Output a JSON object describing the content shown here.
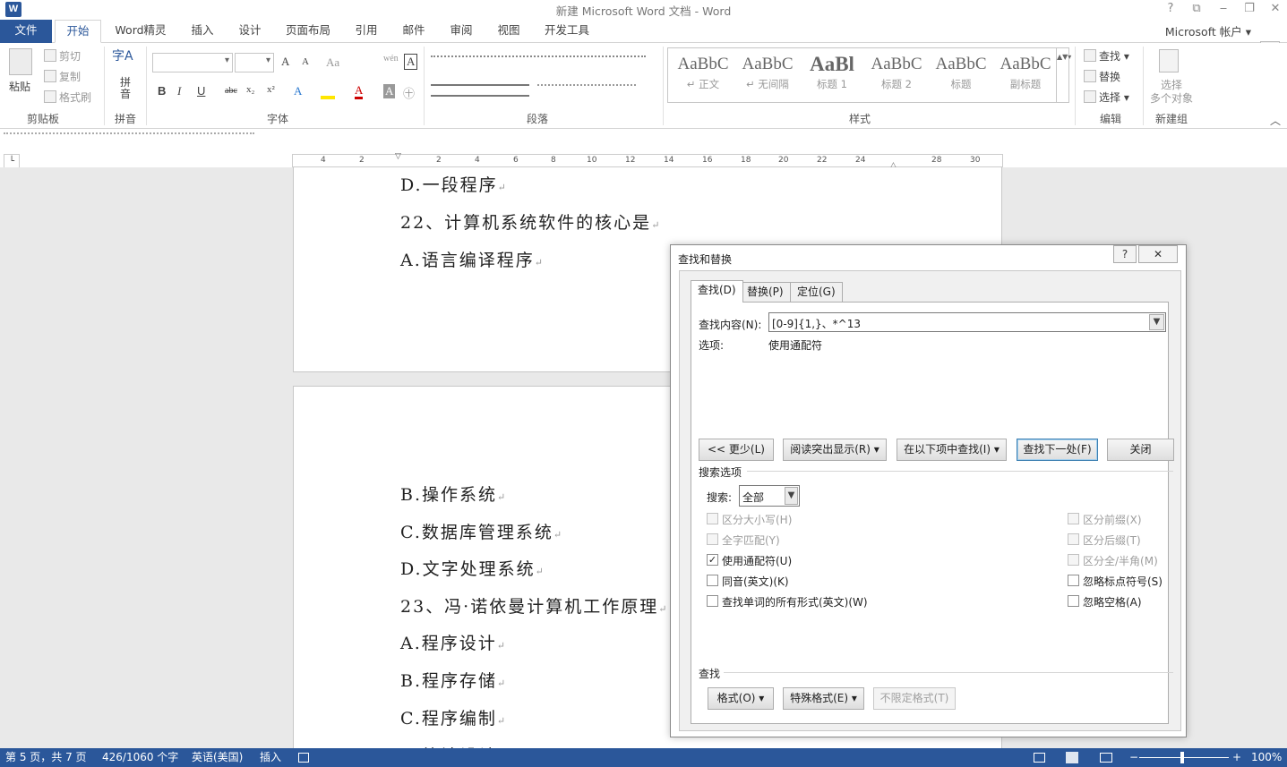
{
  "title_bar": {
    "title": "新建 Microsoft Word 文档 - Word",
    "logo": "W",
    "help": "?",
    "ribbon_display": "⧉",
    "minimize": "‒",
    "restore": "❐",
    "close": "✕"
  },
  "menu_tabs": {
    "file": "文件",
    "home": "开始",
    "word_jl": "Word精灵",
    "insert": "插入",
    "design": "设计",
    "layout": "页面布局",
    "references": "引用",
    "mailings": "邮件",
    "review": "审阅",
    "view": "视图",
    "developer": "开发工具"
  },
  "account": "Microsoft 帐户 ▾",
  "ribbon": {
    "clipboard": {
      "paste": "粘贴",
      "cut": "剪切",
      "copy": "复制",
      "format_painter": "格式刷",
      "group": "剪贴板"
    },
    "pinyin": {
      "label_top": "字A",
      "label": "拼\n音",
      "group": "拼音"
    },
    "font": {
      "group": "字体",
      "bold": "B",
      "italic": "I",
      "underline": "U",
      "strike": "abc",
      "sub": "x₂",
      "sup": "x²",
      "grow": "A",
      "shrink": "A",
      "aa": "Aa",
      "wen": "wén",
      "a_box": "A",
      "a_effect": "A",
      "a_color": "A",
      "a_shade": "A",
      "enclose": "㊉"
    },
    "paragraph": {
      "group": "段落"
    },
    "styles": {
      "group": "样式",
      "items": [
        {
          "sample": "AaBbC",
          "name": "↵ 正文"
        },
        {
          "sample": "AaBbC",
          "name": "↵ 无间隔"
        },
        {
          "sample": "AaBl",
          "name": "标题 1"
        },
        {
          "sample": "AaBbC",
          "name": "标题 2"
        },
        {
          "sample": "AaBbC",
          "name": "标题"
        },
        {
          "sample": "AaBbC",
          "name": "副标题"
        }
      ]
    },
    "editing": {
      "group": "编辑",
      "find": "查找",
      "replace": "替换",
      "select": "选择"
    },
    "new_group": {
      "group": "新建组",
      "label": "选择\n多个对象"
    }
  },
  "ruler_ticks": [
    "4",
    "2",
    "2",
    "4",
    "6",
    "8",
    "10",
    "12",
    "14",
    "16",
    "18",
    "20",
    "22",
    "24",
    "28",
    "30"
  ],
  "document": {
    "lines_page1": [
      "D.一段程序",
      "22、计算机系统软件的核心是",
      "A.语言编译程序"
    ],
    "lines_page2": [
      "B.操作系统",
      "C.数据库管理系统",
      "D.文字处理系统",
      "23、冯·诺依曼计算机工作原理",
      "A.程序设计",
      "B.程序存储",
      "C.程序编制",
      "D.算法设计"
    ],
    "para_mark": "↵"
  },
  "dialog": {
    "title": "查找和替换",
    "help": "?",
    "close": "✕",
    "tabs": [
      "查找(D)",
      "替换(P)",
      "定位(G)"
    ],
    "find_label": "查找内容(N):",
    "find_value": "[0-9]{1,}、*^13",
    "options_label": "选项:",
    "options_value": "使用通配符",
    "buttons": {
      "less": "<< 更少(L)",
      "reading_highlight": "阅读突出显示(R) ▾",
      "find_in": "在以下项中查找(I) ▾",
      "find_next": "查找下一处(F)",
      "close": "关闭"
    },
    "search_options_title": "搜索选项",
    "search_label": "搜索:",
    "search_value": "全部",
    "checks_left": [
      {
        "label": "区分大小写(H)",
        "checked": false,
        "enabled": false
      },
      {
        "label": "全字匹配(Y)",
        "checked": false,
        "enabled": false
      },
      {
        "label": "使用通配符(U)",
        "checked": true,
        "enabled": true
      },
      {
        "label": "同音(英文)(K)",
        "checked": false,
        "enabled": true
      },
      {
        "label": "查找单词的所有形式(英文)(W)",
        "checked": false,
        "enabled": true
      }
    ],
    "checks_right": [
      {
        "label": "区分前缀(X)",
        "checked": false,
        "enabled": false
      },
      {
        "label": "区分后缀(T)",
        "checked": false,
        "enabled": false
      },
      {
        "label": "区分全/半角(M)",
        "checked": false,
        "enabled": false
      },
      {
        "label": "忽略标点符号(S)",
        "checked": false,
        "enabled": true
      },
      {
        "label": "忽略空格(A)",
        "checked": false,
        "enabled": true
      }
    ],
    "find_section": "查找",
    "format_btn": "格式(O) ▾",
    "special_btn": "特殊格式(E) ▾",
    "no_format_btn": "不限定格式(T)"
  },
  "status": {
    "page": "第 5 页，共 7 页",
    "words": "426/1060 个字",
    "language": "英语(美国)",
    "mode": "插入",
    "zoom": "100%",
    "zoom_minus": "−",
    "zoom_plus": "+"
  },
  "colors": {
    "accent": "#2b579a"
  }
}
